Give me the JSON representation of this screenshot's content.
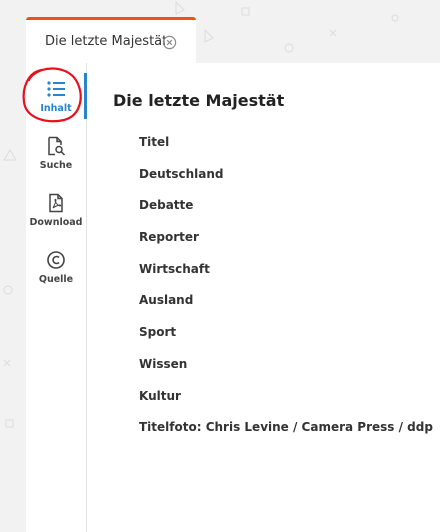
{
  "tab": {
    "title": "Die letzte Majestät"
  },
  "sidebar": {
    "items": [
      {
        "label": "Inhalt",
        "icon": "list-icon",
        "active": true
      },
      {
        "label": "Suche",
        "icon": "document-search-icon",
        "active": false
      },
      {
        "label": "Download",
        "icon": "pdf-icon",
        "active": false
      },
      {
        "label": "Quelle",
        "icon": "copyright-icon",
        "active": false
      }
    ]
  },
  "content": {
    "heading": "Die letzte Majestät",
    "toc": [
      "Titel",
      "Deutschland",
      "Debatte",
      "Reporter",
      "Wirtschaft",
      "Ausland",
      "Sport",
      "Wissen",
      "Kultur",
      "Titelfoto: Chris Levine / Camera Press / ddp"
    ]
  },
  "colors": {
    "accent_orange": "#e8531f",
    "active_blue": "#2a84cc",
    "annotation_red": "#e8101c"
  }
}
